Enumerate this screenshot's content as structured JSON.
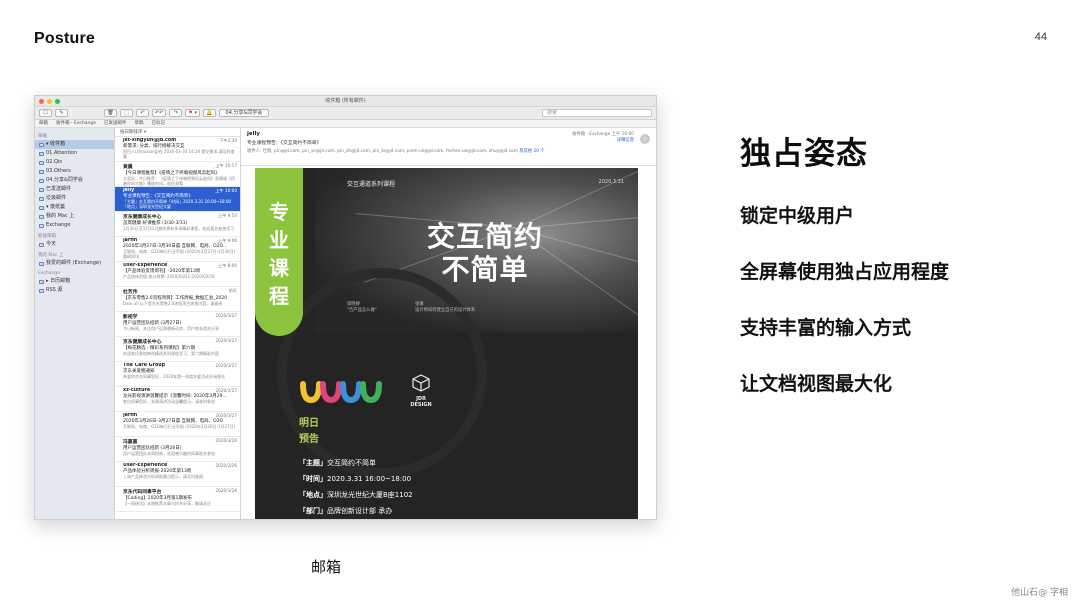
{
  "slide": {
    "brand": "Posture",
    "page_number": "44",
    "caption": "邮箱",
    "watermark": "他山石@  字相"
  },
  "right_panel": {
    "headline": "独占姿态",
    "bullets": [
      "锁定中级用户",
      "全屏幕使用独占应用程度",
      "支持丰富的输入方式",
      "让文档视图最大化"
    ]
  },
  "mail": {
    "window_title": "收件箱 (所有邮件)",
    "toolbar": {
      "buttons": [
        "☐",
        "✎",
        "🗑",
        "⬚",
        "↶",
        "↶↶",
        "↷",
        "⚑ ▾",
        "🔔"
      ],
      "mailbox_picker": "04.分享&同学会",
      "search_placeholder": "搜索"
    },
    "favorites": [
      "邮箱",
      "收件箱 - Exchange",
      "已发送邮件",
      "草稿",
      "已标记"
    ],
    "sidebar": [
      {
        "type": "section",
        "label": "邮箱"
      },
      {
        "type": "item",
        "label": "▾ 收件箱",
        "selected": true
      },
      {
        "type": "item",
        "label": "01.Attention"
      },
      {
        "type": "item",
        "label": "02.Qin"
      },
      {
        "type": "item",
        "label": "03.Others"
      },
      {
        "type": "item",
        "label": "04.分享&同学会"
      },
      {
        "type": "item",
        "label": "已发送邮件"
      },
      {
        "type": "item",
        "label": "垃圾邮件"
      },
      {
        "type": "item",
        "label": "▾ 废纸篓"
      },
      {
        "type": "item",
        "label": "我的 Mac 上"
      },
      {
        "type": "item",
        "label": "Exchange"
      },
      {
        "type": "section",
        "label": "智能邮箱"
      },
      {
        "type": "item",
        "label": "今天"
      },
      {
        "type": "section",
        "label": "我的 Mac 上"
      },
      {
        "type": "item",
        "label": "我爱的邮件 (Exchange)"
      },
      {
        "type": "section",
        "label": "Exchange"
      },
      {
        "type": "item",
        "label": "▸ 日历邮箱"
      },
      {
        "type": "item",
        "label": "RSS 源"
      }
    ],
    "list": {
      "sort_label": "按日期排序 ▾",
      "messages": [
        {
          "from": "jst-xingyun@jd.com",
          "time": "下午2:30",
          "subject": "新需求: 分类、排行榜解决交互",
          "preview": "项目人(zhouxiong)在 2020-03-30 14:28 提交需求,请及时查看",
          "selected": false
        },
        {
          "from": "黄晨",
          "time": "上午 10:17",
          "subject": "【今日课程推荐】《疫情之下终端视频风云起吗》",
          "preview": "大家好，今日推荐：《疫情之下终端视频风云起吗》直播课《用着你吗才能》播放时间，前往观看",
          "selected": false
        },
        {
          "from": "jelly",
          "time": "上午 10:00",
          "subject": "专业课程预告：《交互简约不简单》",
          "preview": "「主题」交互简约不简单「时间」2020.3.31 16:00~18:00「地点」深圳龙光世纪大厦",
          "selected": true
        },
        {
          "from": "京东健康成长中心",
          "time": "上午 9:54",
          "subject": "首席健康-好课推荐 (3/30-3/31)",
          "preview": "3月30日至3月31日期间将有多场精彩课程，欢迎报名参加学习",
          "selected": false
        },
        {
          "from": "jarfin",
          "time": "上午 9:06",
          "subject": "2020年3月27日-3月30日晨 互联网、电商、O2O...",
          "preview": "互联网、电商、O2O每日行业早报 (2020年3月27日-3月30日) 重磅资讯",
          "selected": false
        },
        {
          "from": "User-Experience",
          "time": "上午 8:00",
          "subject": "【产品体验反馈周刊】-2020年第13周",
          "preview": "产品线体验值-统计周期: 2020/03/21-2020/03/28",
          "selected": false
        },
        {
          "from": "杜芳伟",
          "time": "前天",
          "subject": "【京东零售2.0流程项目】工作周报_数据汇总_2020",
          "preview": "Dear all 以下是京东零售2.0流程项目周报内容，请查阅",
          "selected": false
        },
        {
          "from": "影视学",
          "time": "2020/3/27",
          "subject": "用户运营团队招新 (3月27日)",
          "preview": "今日新闻，关注用户运营最新动态，用户增长相关分享",
          "selected": false
        },
        {
          "from": "京东健康成长中心",
          "time": "2020/3/27",
          "subject": "【梅花精选 - 精彩系列课程】第六期",
          "preview": "欢迎各位参加梅花精选系列课程学习，第六期精彩内容",
          "selected": false
        },
        {
          "from": "The Care Group",
          "time": "2020/3/27",
          "subject": "京东关爱圈通知",
          "preview": "亲爱的京东同事您好，2020年第一季度关爱活动开始报名",
          "selected": false
        },
        {
          "from": "xz-culture",
          "time": "2020/3/27",
          "subject": "龙光影视演讲温馨提示《温馨时间: 2020年3月29...",
          "preview": "各位同事您好，本周演讲活动温馨提示，请准时参加",
          "selected": false
        },
        {
          "from": "jarfin",
          "time": "2020/3/27",
          "subject": "2020年3月26日-3月27日晨 互联网、电商、O2O",
          "preview": "互联网、电商、O2O每日行业早报 (2020年3月26日-3月27日)",
          "selected": false
        },
        {
          "from": "冯嘉嘉",
          "time": "2020/3/26",
          "subject": "用户运营团队招新 (3月26日)",
          "preview": "用户运营团队本周招新，欢迎感兴趣的同事报名参加",
          "selected": false
        },
        {
          "from": "User-Experience",
          "time": "2020/3/26",
          "subject": "产品体验分析周报-2020年第13周",
          "preview": "上周产品体验分析周报重点提示，请及时查阅",
          "selected": false
        },
        {
          "from": "京东代码同事平台",
          "time": "2020/3/26",
          "subject": "【Coding】2020年3月第1期发布",
          "preview": "【一周快讯】本期推荐文章与技术分享，敬请关注",
          "selected": false
        }
      ]
    },
    "reader": {
      "from": "jelly",
      "subject": "专业课程预告：《交互简约不简单》",
      "to_label": "收件人:",
      "recipients": "仕佩, pin@jd.com, pin_xc@jd.com, pin_zh@jd.com, pin_ts@jd.com, pinm-ue@jd.com, feshen-ue@jd.com, zhuy@jd.com",
      "more": "及其他 20 个",
      "mailbox": "收件箱 - Exchange",
      "time": "上午 10:00",
      "details": "详细信息",
      "avatar": "J"
    },
    "poster": {
      "band_text": "专业课程",
      "series": "交互通道系列课程",
      "date": "2020.3.31",
      "title_line1": "交互简约",
      "title_line2": "不简单",
      "speaker1_name": "梁晓婷",
      "speaker1_topic": "\"告产品怎么做\"",
      "speaker2_name": "张镇",
      "speaker2_topic": "设计师如何建立自己的设计体系",
      "jdr_line1": "JDR",
      "jdr_line2": "DESIGN",
      "preview_line1": "明日",
      "preview_line2": "预告",
      "details": [
        {
          "key": "「主题」",
          "value": "交互简约不简单"
        },
        {
          "key": "「时间」",
          "value": "2020.3.31 16:00~18:00"
        },
        {
          "key": "「地点」",
          "value": "深圳龙光世纪大厦B座1102"
        },
        {
          "key": "「部门」",
          "value": "品牌创新设计部 承办"
        }
      ]
    }
  },
  "colors": {
    "accent_blue": "#2d5fd0",
    "poster_green": "#8cc43e",
    "poster_bg": "#242424",
    "wave_colors": [
      "#f1c232",
      "#e0447a",
      "#3c8fd8",
      "#43b05c"
    ]
  }
}
